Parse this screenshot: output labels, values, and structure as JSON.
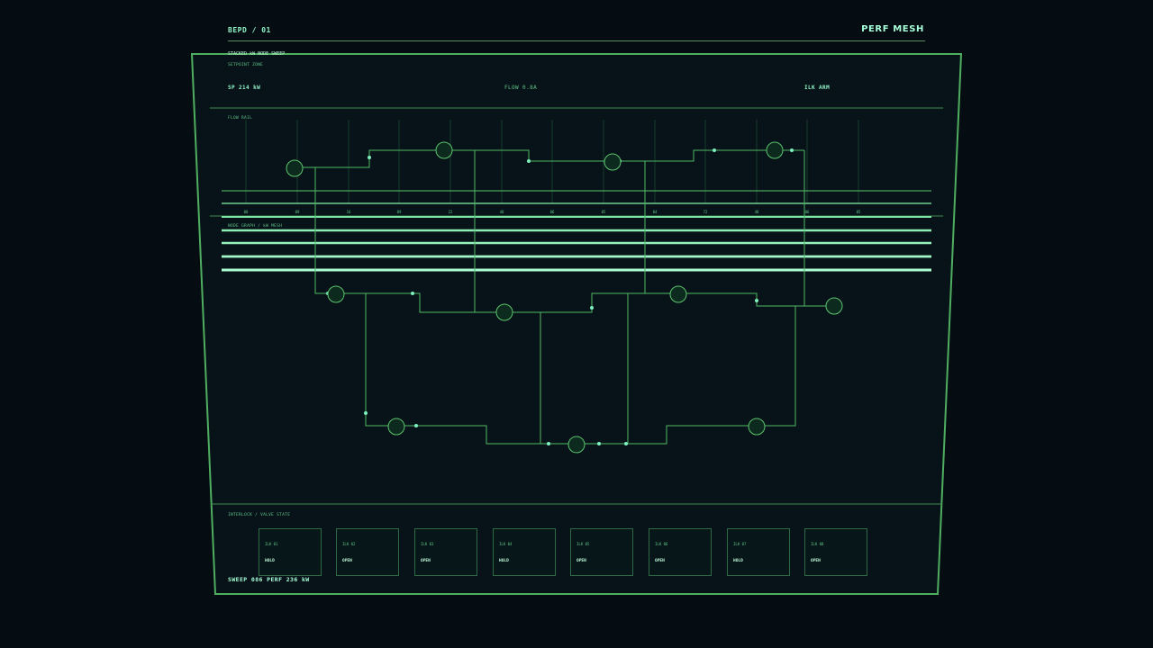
{
  "header": {
    "code": "BEPD / 01",
    "title": "PERF MESH"
  },
  "strip": {
    "title": "STACKED kW NODE SWEEP",
    "right_label": ""
  },
  "setpoint_zone": {
    "label": "SETPOINT ZONE",
    "sp": "SP 214 kW",
    "flow": "FLOW 0.8A",
    "ilk": "ILK ARM"
  },
  "flow_rail": {
    "label": "FLOW RAIL",
    "ticks": [
      "08",
      "09",
      "16",
      "09",
      "22",
      "48",
      "06",
      "05",
      "04",
      "72",
      "48",
      "06",
      "05"
    ]
  },
  "mesh": {
    "label": "NODE GRAPH / kW MESH"
  },
  "interlock": {
    "label": "INTERLOCK / VALVE STATE",
    "valves": [
      {
        "id": "ILK 01",
        "state": "HOLD"
      },
      {
        "id": "ILK 02",
        "state": "OPEN"
      },
      {
        "id": "ILK 03",
        "state": "OPEN"
      },
      {
        "id": "ILK 04",
        "state": "HOLD"
      },
      {
        "id": "ILK 05",
        "state": "OPEN"
      },
      {
        "id": "ILK 06",
        "state": "OPEN"
      },
      {
        "id": "ILK 07",
        "state": "HOLD"
      },
      {
        "id": "ILK 08",
        "state": "OPEN"
      }
    ]
  },
  "footer": {
    "text": "SWEEP 086 PERF 236 kW"
  },
  "colors": {
    "line": "#5cc46e",
    "frame": "#4fae5f",
    "accent": "#7ef0c0",
    "bg": "#050c12"
  }
}
